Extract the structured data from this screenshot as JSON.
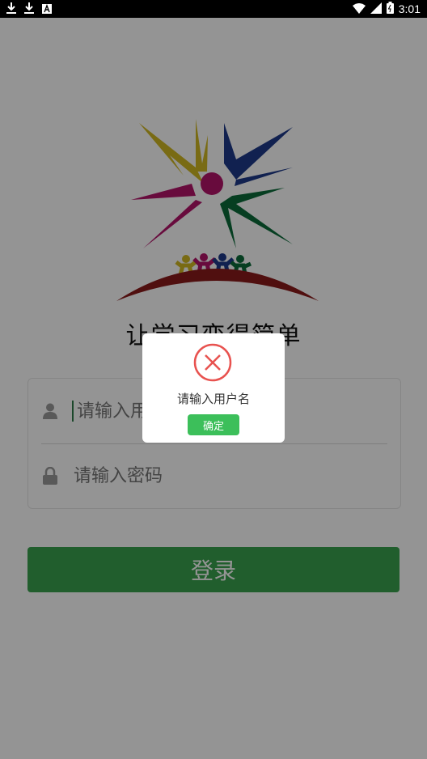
{
  "status": {
    "time": "3:01",
    "left_icons": [
      "download-icon",
      "download-icon",
      "a-icon"
    ],
    "right_icons": [
      "wifi-icon",
      "signal-icon",
      "battery-icon"
    ]
  },
  "app": {
    "slogan": "让学习变得简单"
  },
  "login": {
    "username_placeholder": "请输入用户名",
    "password_placeholder": "请输入密码",
    "login_label": "登录",
    "icons": {
      "username": "user-icon",
      "password": "lock-icon"
    }
  },
  "dialog": {
    "message": "请输入用户名",
    "ok_label": "确定",
    "icon": "error-x-icon"
  },
  "colors": {
    "primary_green": "#3aa34f",
    "dialog_button_green": "#3cbf5a",
    "error_red": "#e8524f",
    "overlay": "rgba(0,0,0,0.42)"
  }
}
